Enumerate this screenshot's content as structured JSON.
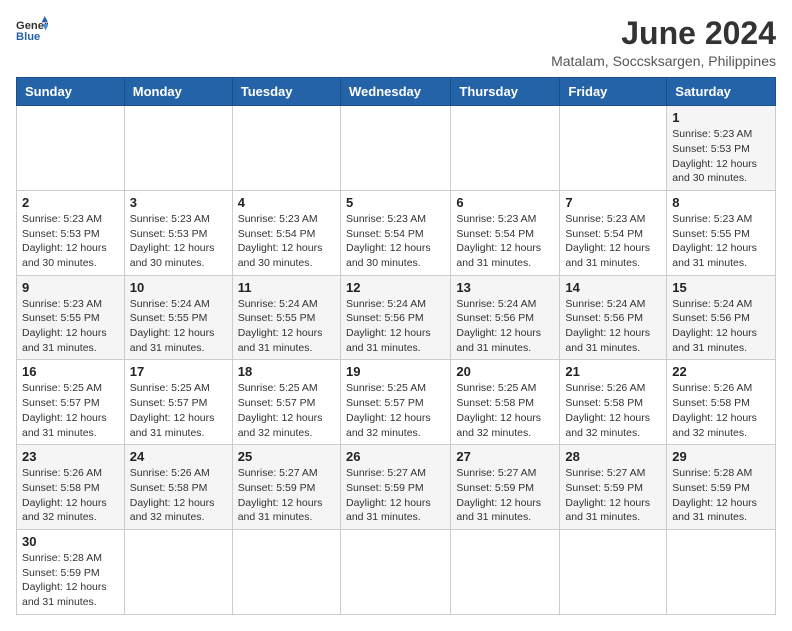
{
  "header": {
    "logo_general": "General",
    "logo_blue": "Blue",
    "month_year": "June 2024",
    "location": "Matalam, Soccsksargen, Philippines"
  },
  "weekdays": [
    "Sunday",
    "Monday",
    "Tuesday",
    "Wednesday",
    "Thursday",
    "Friday",
    "Saturday"
  ],
  "weeks": [
    [
      null,
      null,
      null,
      null,
      null,
      null,
      {
        "day": 1,
        "sunrise": "5:23 AM",
        "sunset": "5:53 PM",
        "daylight": "12 hours and 30 minutes."
      }
    ],
    [
      {
        "day": 2,
        "sunrise": "5:23 AM",
        "sunset": "5:53 PM",
        "daylight": "12 hours and 30 minutes."
      },
      {
        "day": 3,
        "sunrise": "5:23 AM",
        "sunset": "5:53 PM",
        "daylight": "12 hours and 30 minutes."
      },
      {
        "day": 4,
        "sunrise": "5:23 AM",
        "sunset": "5:54 PM",
        "daylight": "12 hours and 30 minutes."
      },
      {
        "day": 5,
        "sunrise": "5:23 AM",
        "sunset": "5:54 PM",
        "daylight": "12 hours and 30 minutes."
      },
      {
        "day": 6,
        "sunrise": "5:23 AM",
        "sunset": "5:54 PM",
        "daylight": "12 hours and 31 minutes."
      },
      {
        "day": 7,
        "sunrise": "5:23 AM",
        "sunset": "5:54 PM",
        "daylight": "12 hours and 31 minutes."
      },
      {
        "day": 8,
        "sunrise": "5:23 AM",
        "sunset": "5:55 PM",
        "daylight": "12 hours and 31 minutes."
      }
    ],
    [
      {
        "day": 9,
        "sunrise": "5:23 AM",
        "sunset": "5:55 PM",
        "daylight": "12 hours and 31 minutes."
      },
      {
        "day": 10,
        "sunrise": "5:24 AM",
        "sunset": "5:55 PM",
        "daylight": "12 hours and 31 minutes."
      },
      {
        "day": 11,
        "sunrise": "5:24 AM",
        "sunset": "5:55 PM",
        "daylight": "12 hours and 31 minutes."
      },
      {
        "day": 12,
        "sunrise": "5:24 AM",
        "sunset": "5:56 PM",
        "daylight": "12 hours and 31 minutes."
      },
      {
        "day": 13,
        "sunrise": "5:24 AM",
        "sunset": "5:56 PM",
        "daylight": "12 hours and 31 minutes."
      },
      {
        "day": 14,
        "sunrise": "5:24 AM",
        "sunset": "5:56 PM",
        "daylight": "12 hours and 31 minutes."
      },
      {
        "day": 15,
        "sunrise": "5:24 AM",
        "sunset": "5:56 PM",
        "daylight": "12 hours and 31 minutes."
      }
    ],
    [
      {
        "day": 16,
        "sunrise": "5:25 AM",
        "sunset": "5:57 PM",
        "daylight": "12 hours and 31 minutes."
      },
      {
        "day": 17,
        "sunrise": "5:25 AM",
        "sunset": "5:57 PM",
        "daylight": "12 hours and 31 minutes."
      },
      {
        "day": 18,
        "sunrise": "5:25 AM",
        "sunset": "5:57 PM",
        "daylight": "12 hours and 32 minutes."
      },
      {
        "day": 19,
        "sunrise": "5:25 AM",
        "sunset": "5:57 PM",
        "daylight": "12 hours and 32 minutes."
      },
      {
        "day": 20,
        "sunrise": "5:25 AM",
        "sunset": "5:58 PM",
        "daylight": "12 hours and 32 minutes."
      },
      {
        "day": 21,
        "sunrise": "5:26 AM",
        "sunset": "5:58 PM",
        "daylight": "12 hours and 32 minutes."
      },
      {
        "day": 22,
        "sunrise": "5:26 AM",
        "sunset": "5:58 PM",
        "daylight": "12 hours and 32 minutes."
      }
    ],
    [
      {
        "day": 23,
        "sunrise": "5:26 AM",
        "sunset": "5:58 PM",
        "daylight": "12 hours and 32 minutes."
      },
      {
        "day": 24,
        "sunrise": "5:26 AM",
        "sunset": "5:58 PM",
        "daylight": "12 hours and 32 minutes."
      },
      {
        "day": 25,
        "sunrise": "5:27 AM",
        "sunset": "5:59 PM",
        "daylight": "12 hours and 31 minutes."
      },
      {
        "day": 26,
        "sunrise": "5:27 AM",
        "sunset": "5:59 PM",
        "daylight": "12 hours and 31 minutes."
      },
      {
        "day": 27,
        "sunrise": "5:27 AM",
        "sunset": "5:59 PM",
        "daylight": "12 hours and 31 minutes."
      },
      {
        "day": 28,
        "sunrise": "5:27 AM",
        "sunset": "5:59 PM",
        "daylight": "12 hours and 31 minutes."
      },
      {
        "day": 29,
        "sunrise": "5:28 AM",
        "sunset": "5:59 PM",
        "daylight": "12 hours and 31 minutes."
      }
    ],
    [
      {
        "day": 30,
        "sunrise": "5:28 AM",
        "sunset": "5:59 PM",
        "daylight": "12 hours and 31 minutes."
      },
      null,
      null,
      null,
      null,
      null,
      null
    ]
  ]
}
